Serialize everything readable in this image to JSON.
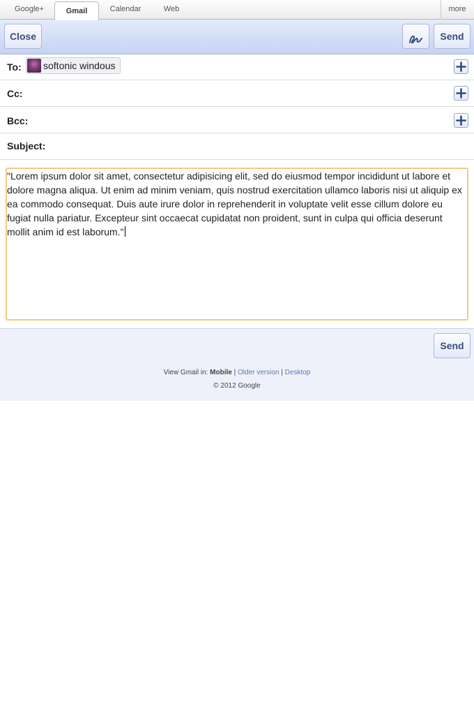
{
  "tabs": [
    {
      "label": "Google+",
      "active": false
    },
    {
      "label": "Gmail",
      "active": true
    },
    {
      "label": "Calendar",
      "active": false
    },
    {
      "label": "Web",
      "active": false
    }
  ],
  "more_label": "more",
  "toolbar": {
    "close_label": "Close",
    "send_label": "Send",
    "handwriting_icon": "handwriting-icon"
  },
  "compose": {
    "to_label": "To:",
    "to_recipient": "softonic windous",
    "cc_label": "Cc:",
    "bcc_label": "Bcc:",
    "subject_label": "Subject:",
    "subject_value": "",
    "body": "\"Lorem ipsum dolor sit amet, consectetur adipisicing elit, sed do eiusmod tempor incididunt ut labore et dolore magna aliqua. Ut enim ad minim veniam, quis nostrud exercitation ullamco laboris nisi ut aliquip ex ea commodo consequat. Duis aute irure dolor in reprehenderit in voluptate velit esse cillum dolore eu fugiat nulla pariatur. Excepteur sint occaecat cupidatat non proident, sunt in culpa qui officia deserunt mollit anim id est laborum.\""
  },
  "bottom": {
    "send_label": "Send"
  },
  "footer": {
    "view_prefix": "View Gmail in:",
    "mobile": "Mobile",
    "separator": "|",
    "older": "Older version",
    "desktop": "Desktop",
    "copyright": "© 2012 Google"
  },
  "colors": {
    "accent": "#c5d3f3",
    "body_border": "#f2c987",
    "link": "#5b78b8"
  }
}
